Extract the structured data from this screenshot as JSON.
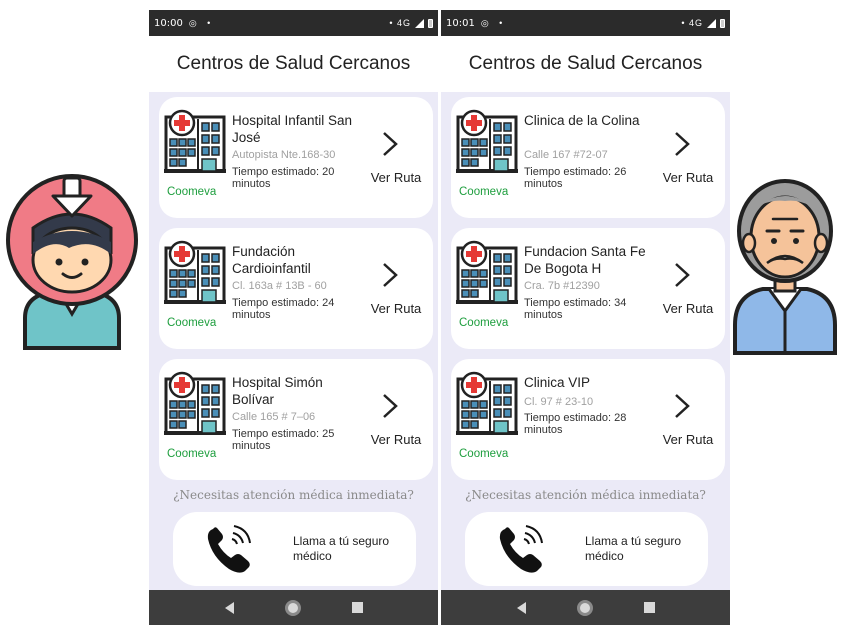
{
  "colors": {
    "app_background": "#ebeaf7",
    "card": "#ffffff",
    "insurer_green": "#1e9e3e",
    "address_gray": "#a0a0a0",
    "status_bar": "#2b2b2b",
    "nav_bar": "#3d3d3d"
  },
  "left_screen": {
    "status_bar": {
      "time": "10:00",
      "icons": "◎ •",
      "right": "• 4G"
    },
    "title": "Centros de Salud Cercanos",
    "centers": [
      {
        "name": "Hospital Infantil San José",
        "address": "Autopista Nte.168-30",
        "time": "Tiempo estimado: 20 minutos",
        "insurer": "Coomeva",
        "action": "Ver Ruta",
        "icon": "hospital-icon"
      },
      {
        "name": "Fundación Cardioinfantil",
        "address": "Cl. 163a # 13B - 60",
        "time": "Tiempo estimado: 24 minutos",
        "insurer": "Coomeva",
        "action": "Ver Ruta",
        "icon": "hospital-icon"
      },
      {
        "name": "Hospital Simón Bolívar",
        "address": "Calle 165 # 7–06",
        "time": "Tiempo estimado: 25 minutos",
        "insurer": "Coomeva",
        "action": "Ver Ruta",
        "icon": "hospital-icon"
      }
    ],
    "urgent_question": "¿Necesitas atención médica inmediata?",
    "call_label": "Llama a tú seguro médico",
    "call_icon": "phone-call-icon"
  },
  "right_screen": {
    "status_bar": {
      "time": "10:01",
      "icons": "◎ •",
      "right": "• 4G"
    },
    "title": "Centros de Salud Cercanos",
    "centers": [
      {
        "name": "Clinica de la Colina",
        "address": "Calle 167 #72-07",
        "time": "Tiempo estimado: 26 minutos",
        "insurer": "Coomeva",
        "action": "Ver Ruta",
        "icon": "hospital-icon"
      },
      {
        "name": "Fundacion Santa Fe De Bogota H",
        "address": "Cra. 7b #12390",
        "time": "Tiempo estimado: 34 minutos",
        "insurer": "Coomeva",
        "action": "Ver Ruta",
        "icon": "hospital-icon"
      },
      {
        "name": "Clinica VIP",
        "address": "Cl. 97 # 23-10",
        "time": "Tiempo estimado: 28 minutos",
        "insurer": "Coomeva",
        "action": "Ver Ruta",
        "icon": "hospital-icon"
      }
    ],
    "urgent_question": "¿Necesitas atención médica inmediata?",
    "call_label": "Llama a tú seguro médico",
    "call_icon": "phone-call-icon"
  },
  "illustrations": {
    "left": "child-with-helmet-avatar",
    "right": "elderly-man-avatar"
  }
}
